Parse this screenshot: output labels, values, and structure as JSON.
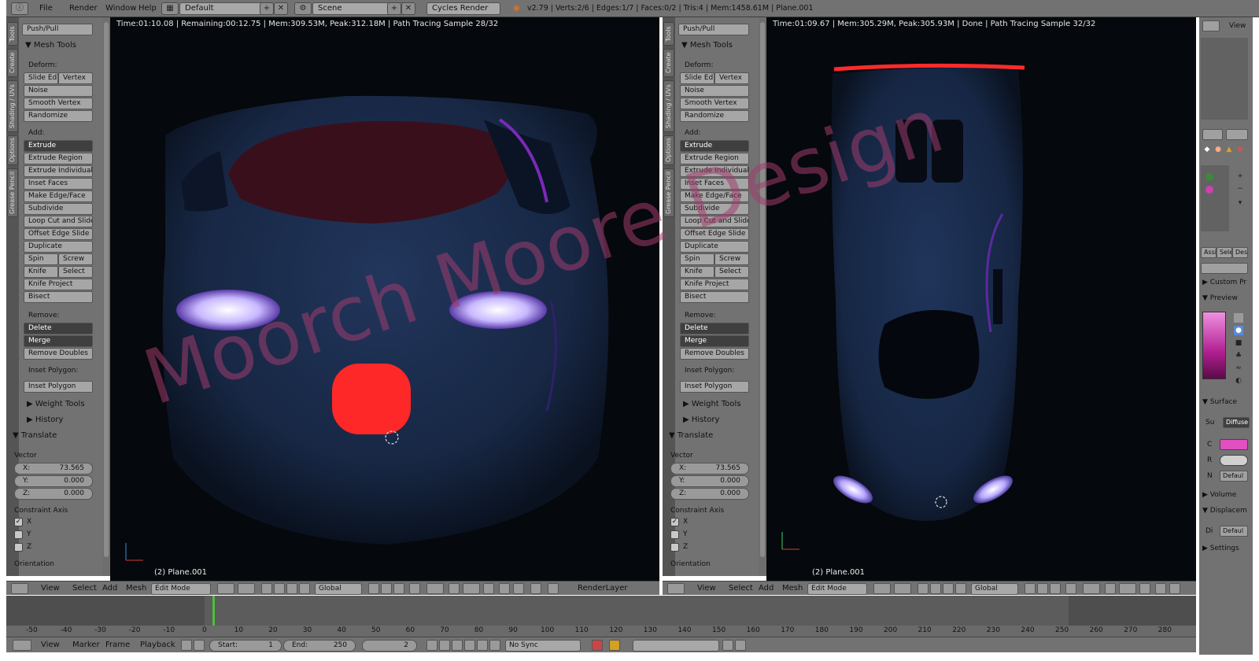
{
  "topbar": {
    "menus": [
      "File",
      "Render",
      "Window",
      "Help"
    ],
    "screen_layout": "Default",
    "scene": "Scene",
    "render_engine": "Cycles Render",
    "stats": "v2.79 | Verts:2/6 | Edges:1/7 | Faces:0/2 | Tris:4 | Mem:1458.61M | Plane.001"
  },
  "tabs": [
    "Tools",
    "Create",
    "Shading / UVs",
    "Options",
    "Grease Pencil"
  ],
  "tool_panel": {
    "top_button": "Push/Pull",
    "mesh_tools": "Mesh Tools",
    "deform_label": "Deform:",
    "slide_edge": "Slide Ed",
    "vertex": "Vertex",
    "noise": "Noise",
    "smooth_vertex": "Smooth Vertex",
    "randomize": "Randomize",
    "add_label": "Add:",
    "extrude": "Extrude",
    "extrude_region": "Extrude Region",
    "extrude_individual": "Extrude Individual",
    "inset_faces": "Inset Faces",
    "make_edge_face": "Make Edge/Face",
    "subdivide": "Subdivide",
    "loop_cut": "Loop Cut and Slide",
    "offset_edge": "Offset Edge Slide",
    "duplicate": "Duplicate",
    "spin": "Spin",
    "screw": "Screw",
    "knife": "Knife",
    "select": "Select",
    "knife_project": "Knife Project",
    "bisect": "Bisect",
    "remove_label": "Remove:",
    "delete": "Delete",
    "merge": "Merge",
    "remove_doubles": "Remove Doubles",
    "inset_polygon_label": "Inset Polygon:",
    "inset_polygon": "Inset Polygon",
    "weight_tools": "Weight Tools",
    "history": "History",
    "translate": "Translate",
    "vector_label": "Vector",
    "x_label": "X:",
    "x_value": "73.565",
    "y_label": "Y:",
    "y_value": "0.000",
    "z_label": "Z:",
    "z_value": "0.000",
    "constraint_axis": "Constraint Axis",
    "axis_x": "X",
    "axis_y": "Y",
    "axis_z": "Z",
    "orientation": "Orientation",
    "check_mark": "✓"
  },
  "viewport_left": {
    "status": "Time:01:10.08 | Remaining:00:12.75 | Mem:309.53M, Peak:312.18M | Path Tracing Sample 28/32",
    "object": "(2) Plane.001"
  },
  "viewport_right": {
    "status": "Time:01:09.67 | Mem:305.29M, Peak:305.93M | Done | Path Tracing Sample 32/32",
    "object": "(2) Plane.001"
  },
  "view_header": {
    "view": "View",
    "select": "Select",
    "add": "Add",
    "mesh": "Mesh",
    "mode": "Edit Mode",
    "orientation": "Global",
    "render_layer": "RenderLayer"
  },
  "timeline": {
    "ticks": [
      "-50",
      "-40",
      "-30",
      "-20",
      "-10",
      "0",
      "10",
      "20",
      "30",
      "40",
      "50",
      "60",
      "70",
      "80",
      "90",
      "100",
      "110",
      "120",
      "130",
      "140",
      "150",
      "160",
      "170",
      "180",
      "190",
      "200",
      "210",
      "220",
      "230",
      "240",
      "250",
      "260",
      "270",
      "280"
    ],
    "current_frame_marker": 2,
    "view": "View",
    "marker": "Marker",
    "frame": "Frame",
    "playback": "Playback",
    "start_label": "Start:",
    "start_value": "1",
    "end_label": "End:",
    "end_value": "250",
    "current": "2",
    "sync": "No Sync"
  },
  "right_panel": {
    "view_label": "View",
    "custom_props": "Custom Pr",
    "preview": "Preview",
    "surface": "Surface",
    "su_label": "Su",
    "diffuse": "Diffuse",
    "c_label": "C",
    "r_label": "R",
    "n_label": "N",
    "default1": "Defaul",
    "volume": "Volume",
    "displacement": "Displacem",
    "di_label": "Di",
    "default2": "Defaul",
    "settings": "Settings",
    "assign": "Assi",
    "select": "Sele",
    "deselect": "Des"
  },
  "watermark": "Moorch Moore Design",
  "colors": {
    "ui_gray": "#727272",
    "viewport_bg": "#05080c",
    "car_body": "#1b2c4f",
    "tail_light": "#e02020",
    "material_pink": "#d040b0",
    "watermark": "#a03c6e",
    "playhead": "#4fbf3a"
  }
}
